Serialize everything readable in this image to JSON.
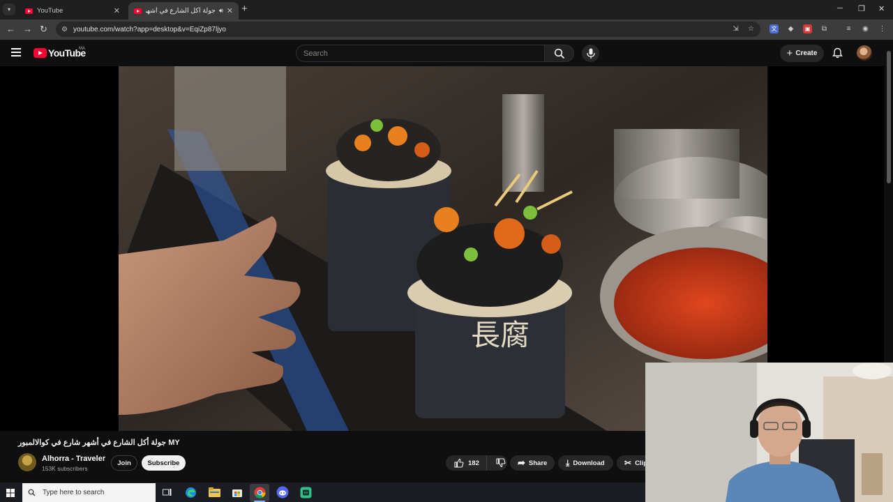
{
  "browser": {
    "tabs": [
      {
        "title": "YouTube",
        "active": false
      },
      {
        "title": "جولة أكل الشارع في أشهر شا",
        "active": true
      }
    ],
    "url": "youtube.com/watch?app=desktop&v=EqiZp87ljyo"
  },
  "youtube": {
    "logo_text": "YouTube",
    "country_code": "MA",
    "search_placeholder": "Search",
    "create_label": "Create"
  },
  "video": {
    "title": "جولة أكل الشارع في أشهر شارع في كوالالمبور MY",
    "channel_name": "Alhorra - Traveler",
    "subscribers": "153K subscribers",
    "join_label": "Join",
    "subscribe_label": "Subscribe",
    "likes": "182",
    "share_label": "Share",
    "download_label": "Download",
    "clip_label": "Clip"
  },
  "taskbar": {
    "search_placeholder": "Type here to search"
  },
  "colors": {
    "youtube_red": "#ff0033",
    "background": "#0f0f0f",
    "pill": "#272727"
  }
}
